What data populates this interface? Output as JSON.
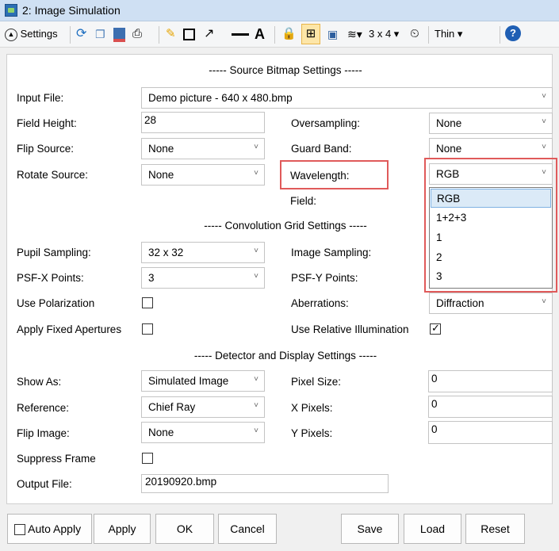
{
  "window": {
    "title": "2: Image Simulation"
  },
  "toolbar": {
    "settings_label": "Settings",
    "grid_label": "3 x 4",
    "thin_label": "Thin"
  },
  "sections": {
    "source": "----- Source Bitmap Settings -----",
    "convolution": "----- Convolution Grid Settings -----",
    "detector": "----- Detector and Display Settings -----"
  },
  "source": {
    "input_file_label": "Input File:",
    "input_file_value": "Demo picture -  640 x 480.bmp",
    "field_height_label": "Field Height:",
    "field_height_value": "28",
    "oversampling_label": "Oversampling:",
    "oversampling_value": "None",
    "flip_source_label": "Flip Source:",
    "flip_source_value": "None",
    "guard_band_label": "Guard Band:",
    "guard_band_value": "None",
    "rotate_source_label": "Rotate Source:",
    "rotate_source_value": "None",
    "wavelength_label": "Wavelength:",
    "wavelength_value": "RGB",
    "field_label": "Field:"
  },
  "wavelength_options": [
    "RGB",
    "1+2+3",
    "1",
    "2",
    "3"
  ],
  "convolution": {
    "pupil_sampling_label": "Pupil Sampling:",
    "pupil_sampling_value": "32 x 32",
    "image_sampling_label": "Image Sampling:",
    "psfx_label": "PSF-X Points:",
    "psfx_value": "3",
    "psfy_label": "PSF-Y Points:",
    "use_polarization_label": "Use Polarization",
    "aberrations_label": "Aberrations:",
    "aberrations_value": "Diffraction",
    "apply_fixed_apertures_label": "Apply Fixed Apertures",
    "use_relative_illumination_label": "Use Relative Illumination"
  },
  "detector": {
    "show_as_label": "Show As:",
    "show_as_value": "Simulated Image",
    "pixel_size_label": "Pixel Size:",
    "pixel_size_value": "0",
    "reference_label": "Reference:",
    "reference_value": "Chief Ray",
    "x_pixels_label": "X Pixels:",
    "x_pixels_value": "0",
    "flip_image_label": "Flip Image:",
    "flip_image_value": "None",
    "y_pixels_label": "Y Pixels:",
    "y_pixels_value": "0",
    "suppress_frame_label": "Suppress Frame",
    "output_file_label": "Output File:",
    "output_file_value": "20190920.bmp"
  },
  "buttons": {
    "auto_apply": "Auto Apply",
    "apply": "Apply",
    "ok": "OK",
    "cancel": "Cancel",
    "save": "Save",
    "load": "Load",
    "reset": "Reset"
  },
  "colors": {
    "highlight_red": "#e05a5a",
    "accent_blue": "#1f6fc0"
  }
}
